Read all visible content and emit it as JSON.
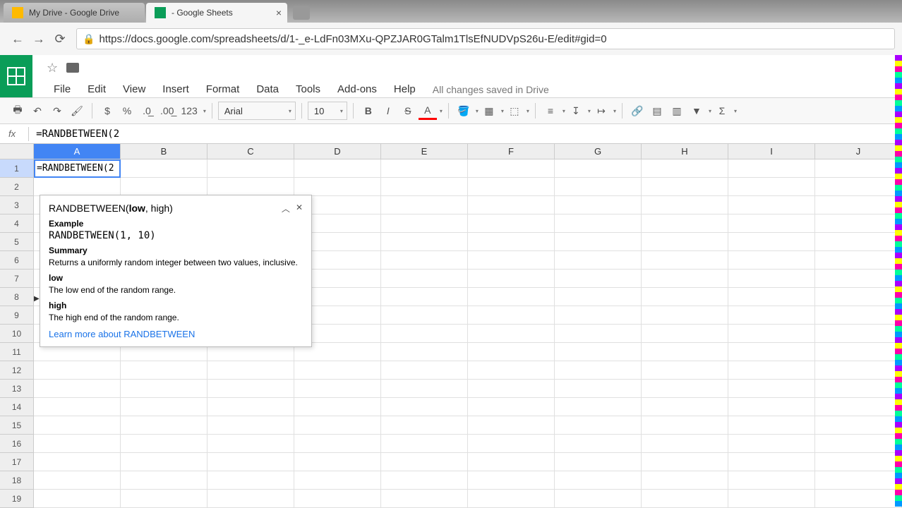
{
  "browser": {
    "tabs": [
      {
        "title": "My Drive - Google Drive",
        "active": false
      },
      {
        "title": " - Google Sheets",
        "active": true
      }
    ],
    "url": "https://docs.google.com/spreadsheets/d/1-_e-LdFn03MXu-QPZJAR0GTalm1TlsEfNUDVpS26u-E/edit#gid=0"
  },
  "menu": {
    "file": "File",
    "edit": "Edit",
    "view": "View",
    "insert": "Insert",
    "format": "Format",
    "data": "Data",
    "tools": "Tools",
    "addons": "Add-ons",
    "help": "Help",
    "saved": "All changes saved in Drive"
  },
  "toolbar": {
    "currency": "$",
    "percent": "%",
    "dec_less": ".0←",
    "dec_more": ".00→",
    "more_formats": "123",
    "font": "Arial",
    "font_size": "10",
    "bold": "B",
    "italic": "I",
    "strike": "S",
    "text_color": "A"
  },
  "formula_bar": {
    "fx": "fx",
    "value": "=RANDBETWEEN(2"
  },
  "grid": {
    "columns": [
      "A",
      "B",
      "C",
      "D",
      "E",
      "F",
      "G",
      "H",
      "I",
      "J"
    ],
    "rows": [
      "1",
      "2",
      "3",
      "4",
      "5",
      "6",
      "7",
      "8",
      "9",
      "10",
      "11",
      "12",
      "13",
      "14",
      "15",
      "16",
      "17",
      "18",
      "19"
    ],
    "editing_cell": "=RANDBETWEEN(2"
  },
  "tooltip": {
    "signature_fn": "RANDBETWEEN(",
    "signature_arg1": "low",
    "signature_rest": ", high)",
    "example_label": "Example",
    "example": "RANDBETWEEN(1, 10)",
    "summary_label": "Summary",
    "summary": "Returns a uniformly random integer between two values, inclusive.",
    "arg1_name": "low",
    "arg1_desc": "The low end of the random range.",
    "arg2_name": "high",
    "arg2_desc": "The high end of the random range.",
    "link": "Learn more about RANDBETWEEN"
  }
}
